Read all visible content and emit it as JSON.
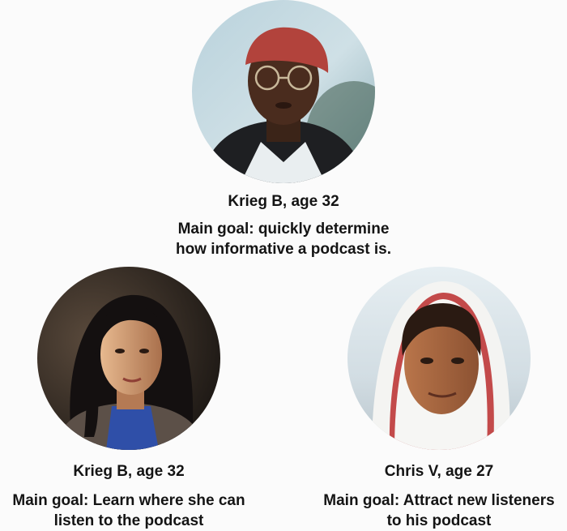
{
  "personas": [
    {
      "name": "Krieg B, age 32",
      "goal_line1": "Main goal: quickly determine",
      "goal_line2": "how informative a podcast is."
    },
    {
      "name": "Krieg B, age 32",
      "goal_line1": "Main goal: Learn where she can",
      "goal_line2": "listen to the podcast"
    },
    {
      "name": "Chris V, age 27",
      "goal_line1": "Main goal: Attract new listeners",
      "goal_line2": "to his podcast"
    }
  ],
  "colors": {
    "background": "#fbfbfb",
    "text": "#141414"
  },
  "icons": [
    "avatar-photo-man-red-cap",
    "avatar-photo-woman-dark-hair",
    "avatar-photo-boy-white-hood"
  ]
}
